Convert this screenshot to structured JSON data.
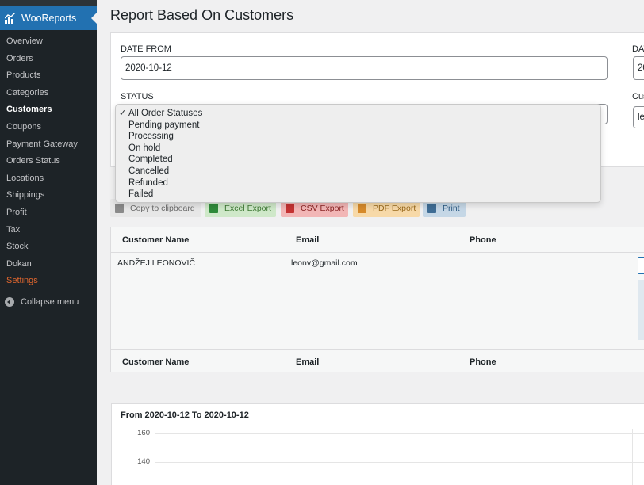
{
  "sidebar": {
    "brand": "WooReports",
    "items": [
      {
        "label": "Overview"
      },
      {
        "label": "Orders"
      },
      {
        "label": "Products"
      },
      {
        "label": "Categories"
      },
      {
        "label": "Customers",
        "active": true
      },
      {
        "label": "Coupons"
      },
      {
        "label": "Payment Gateway"
      },
      {
        "label": "Orders Status"
      },
      {
        "label": "Locations"
      },
      {
        "label": "Shippings"
      },
      {
        "label": "Profit"
      },
      {
        "label": "Tax"
      },
      {
        "label": "Stock"
      },
      {
        "label": "Dokan"
      },
      {
        "label": "Settings",
        "highlight": true
      }
    ],
    "collapse_label": "Collapse menu"
  },
  "page": {
    "title": "Report Based On Customers"
  },
  "filters": {
    "date_from_label": "DATE FROM",
    "date_from_value": "2020-10-12",
    "date_to_label_partial": "DAT",
    "date_to_value_partial": "20",
    "status_label": "STATUS",
    "customer_label_partial": "Cus",
    "customer_value_partial": "le"
  },
  "status_dropdown": {
    "selected": "All Order Statuses",
    "options": [
      "All Order Statuses",
      "Pending payment",
      "Processing",
      "On hold",
      "Completed",
      "Cancelled",
      "Refunded",
      "Failed"
    ]
  },
  "export_buttons": [
    {
      "label": "Copy to clipboard",
      "icon": "clipboard-icon"
    },
    {
      "label": "Excel Export",
      "icon": "excel-icon"
    },
    {
      "label": "CSV Export",
      "icon": "csv-icon"
    },
    {
      "label": "PDF Export",
      "icon": "pdf-icon"
    },
    {
      "label": "Print",
      "icon": "printer-icon"
    }
  ],
  "table": {
    "columns": [
      "Customer Name",
      "Email",
      "Phone"
    ],
    "rows": [
      {
        "name": "ANDŽEJ LEONOVIČ",
        "email": "leonv@gmail.com",
        "phone": ""
      }
    ],
    "footer_columns": [
      "Customer Name",
      "Email",
      "Phone"
    ]
  },
  "chart": {
    "title": "From 2020-10-12 To 2020-10-12",
    "chart_data": {
      "type": "line",
      "title": "From 2020-10-12 To 2020-10-12",
      "y_ticks": [
        160,
        140
      ],
      "grid": true
    }
  },
  "colors": {
    "sidebar_bg": "#1d2327",
    "brand_bg": "#2271b1",
    "settings_accent": "#e0662e"
  }
}
